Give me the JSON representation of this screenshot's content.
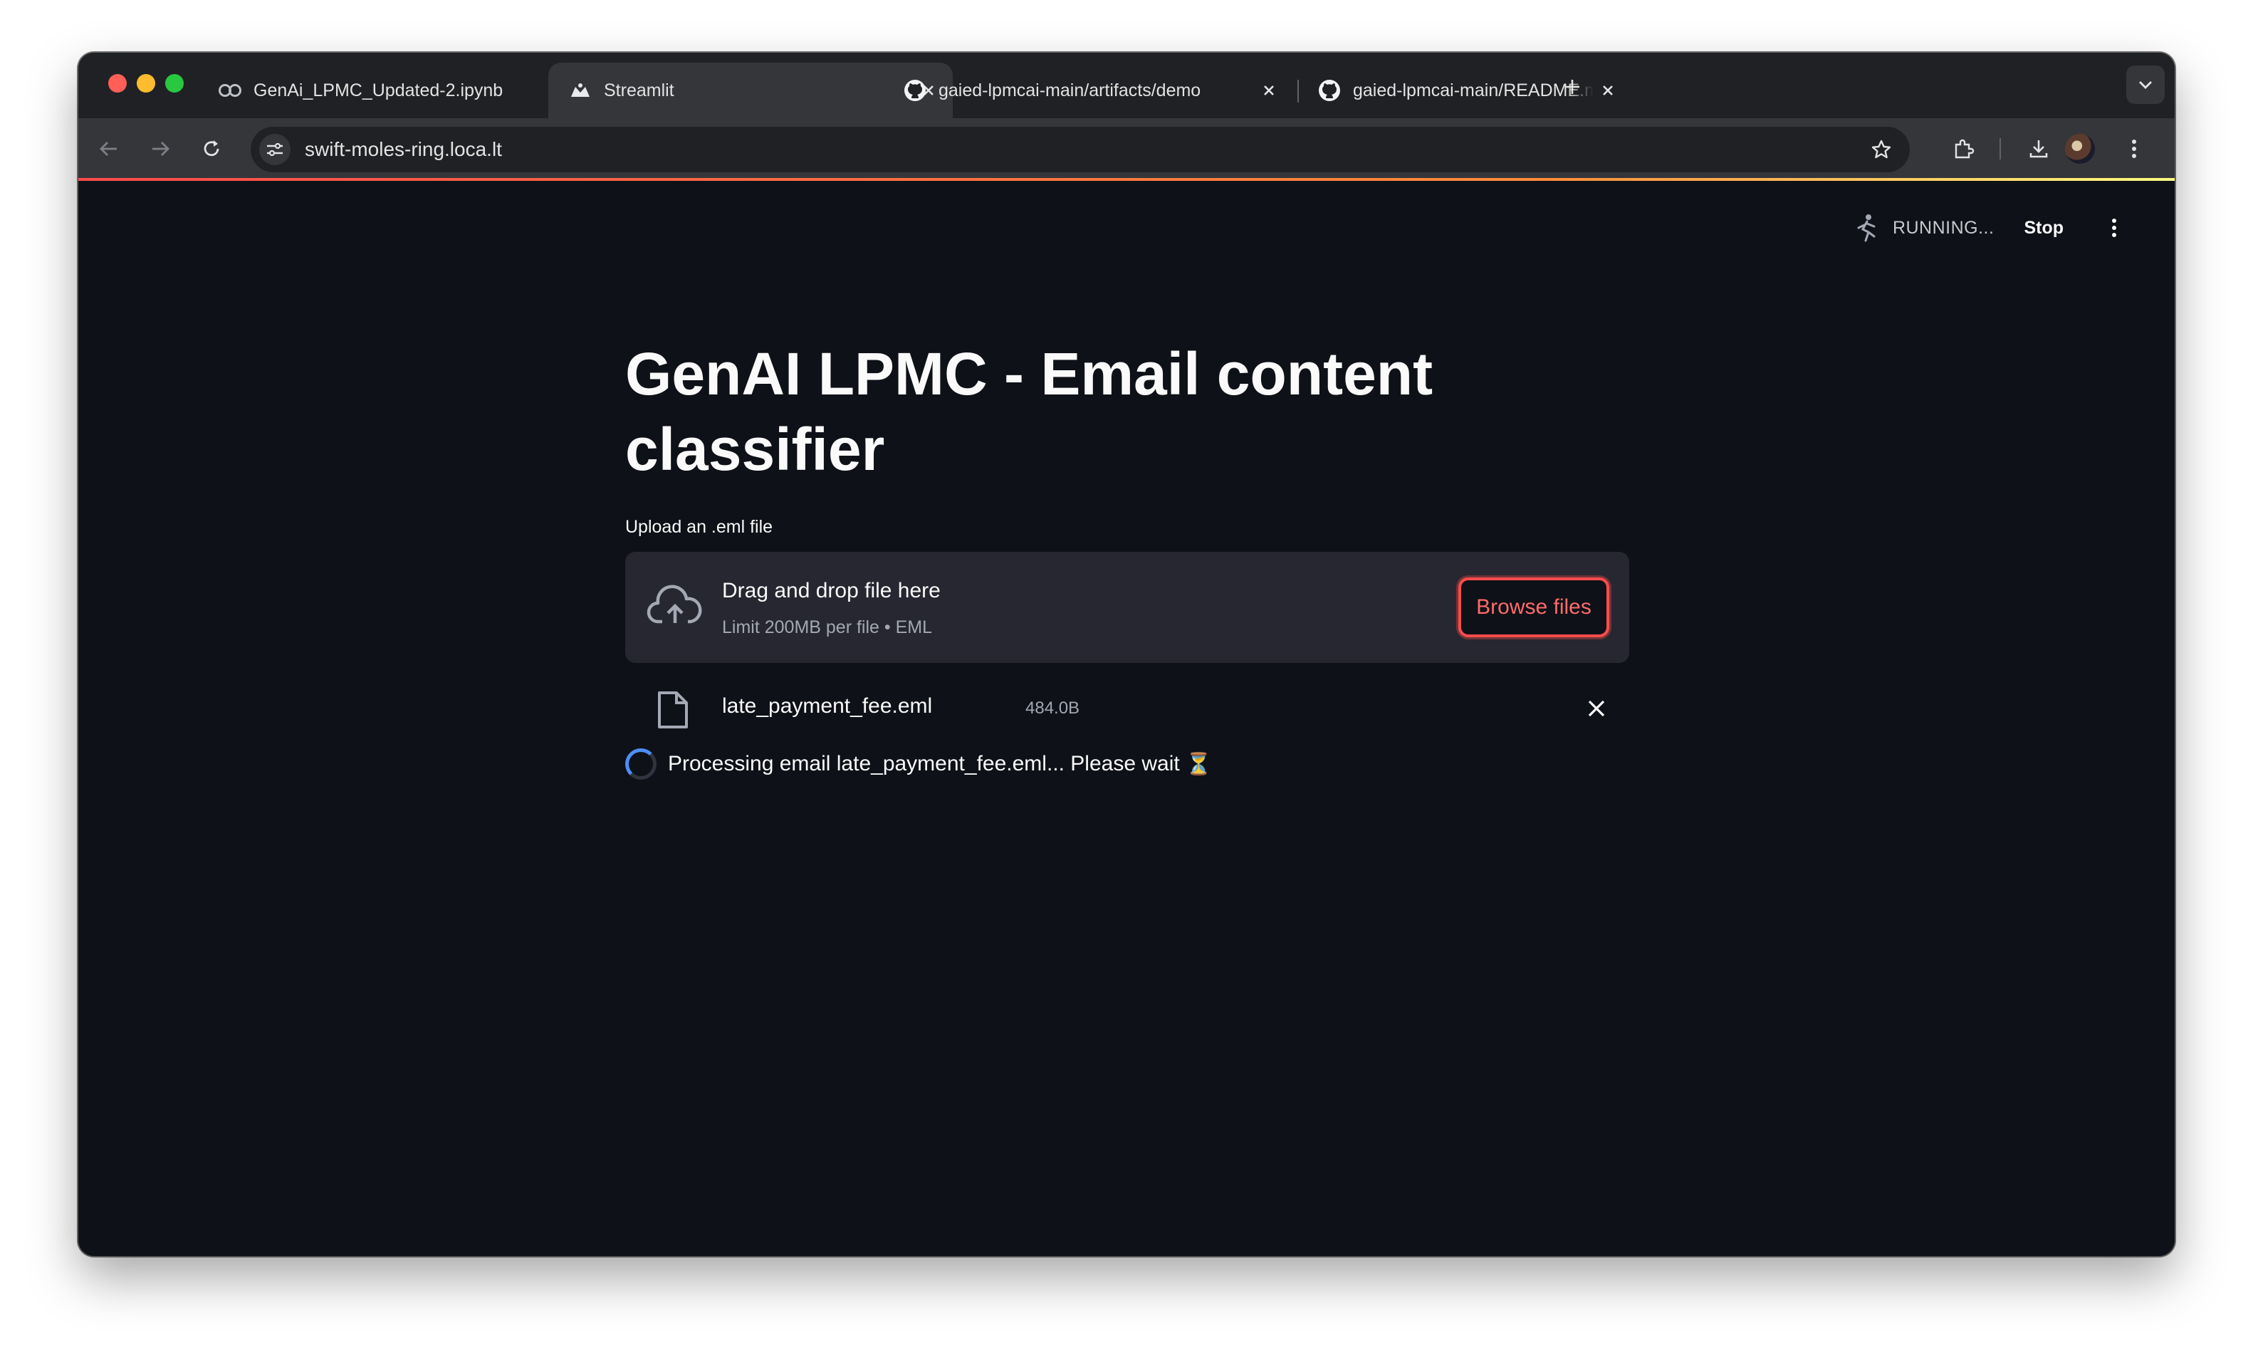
{
  "browser": {
    "tabs": [
      {
        "label": "GenAi_LPMC_Updated-2.ipynb",
        "icon": "colab-icon",
        "active": false
      },
      {
        "label": "Streamlit",
        "icon": "streamlit-icon",
        "active": true
      },
      {
        "label": "gaied-lpmcai-main/artifacts/demo",
        "icon": "github-icon",
        "active": false
      },
      {
        "label": "gaied-lpmcai-main/README.md",
        "icon": "github-icon",
        "active": false
      }
    ],
    "url": "swift-moles-ring.loca.lt"
  },
  "app": {
    "status": {
      "running": "RUNNING...",
      "stop": "Stop"
    },
    "title": "GenAI LPMC - Email content classifier",
    "uploader": {
      "label": "Upload an .eml file",
      "drag_text": "Drag and drop file here",
      "limit_text": "Limit 200MB per file • EML",
      "browse_label": "Browse files"
    },
    "file": {
      "name": "late_payment_fee.eml",
      "size": "484.0B"
    },
    "processing_text": "Processing email late_payment_fee.eml... Please wait",
    "processing_emoji": "⏳"
  },
  "colors": {
    "accent": "#ff4b4b",
    "background": "#0e1117",
    "dropzone": "#262730",
    "spinner": "#4f8df7"
  }
}
